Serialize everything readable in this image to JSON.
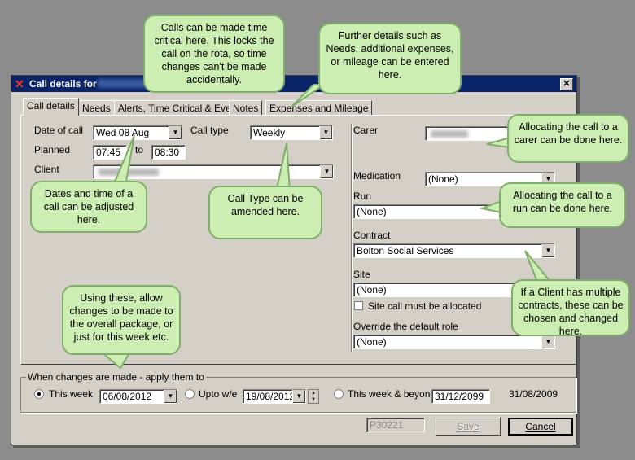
{
  "window": {
    "title": "Call details for",
    "close_label": "✕"
  },
  "tabs": [
    "Call details",
    "Needs",
    "Alerts, Time Critical & Event",
    "Notes",
    "Expenses and Mileage"
  ],
  "left": {
    "date_of_call_label": "Date of call",
    "date_of_call_value": "Wed 08 Aug",
    "call_type_label": "Call type",
    "call_type_value": "Weekly",
    "planned_label": "Planned",
    "planned_start": "07:45",
    "to_label": "to",
    "planned_end": "08:30",
    "client_label": "Client"
  },
  "right": {
    "carer_label": "Carer",
    "medication_label": "Medication",
    "medication_value": "(None)",
    "run_label": "Run",
    "run_value": "(None)",
    "contract_label": "Contract",
    "contract_value": "Bolton Social Services",
    "site_label": "Site",
    "site_value": "(None)",
    "site_must_allocate_label": "Site call must be allocated",
    "override_role_label": "Override the default role",
    "override_role_value": "(None)"
  },
  "apply_group": {
    "title": "When changes are made - apply them to",
    "this_week_label": "This week",
    "this_week_date": "06/08/2012",
    "upto_label": "Upto w/e",
    "upto_date": "19/08/2012",
    "beyond_label": "This week & beyond",
    "beyond_date": "31/12/2099",
    "end_date": "31/08/2009"
  },
  "footer": {
    "ref": "P30221",
    "save_label": "Save",
    "cancel_label": "Cancel"
  },
  "callouts": {
    "time_critical": "Calls can be made time critical here. This locks the call on the rota, so time changes can't be made accidentally.",
    "further_details": "Further details such as Needs, additional expenses, or mileage can be entered here.",
    "carer": "Allocating the call to a carer can be done here.",
    "run": "Allocating the call to a run can be done here.",
    "dates": "Dates and time of a call can be adjusted here.",
    "call_type": "Call Type can be amended here.",
    "contracts": "If a Client has multiple contracts, these can be chosen and changed here.",
    "apply": "Using these, allow changes to be made to the overall package, or just for this week etc."
  },
  "colors": {
    "callout_fill": "#cdeeb3",
    "callout_border": "#7fae6a",
    "titlebar": "#0a246a",
    "dialog_bg": "#d4d0c8"
  }
}
